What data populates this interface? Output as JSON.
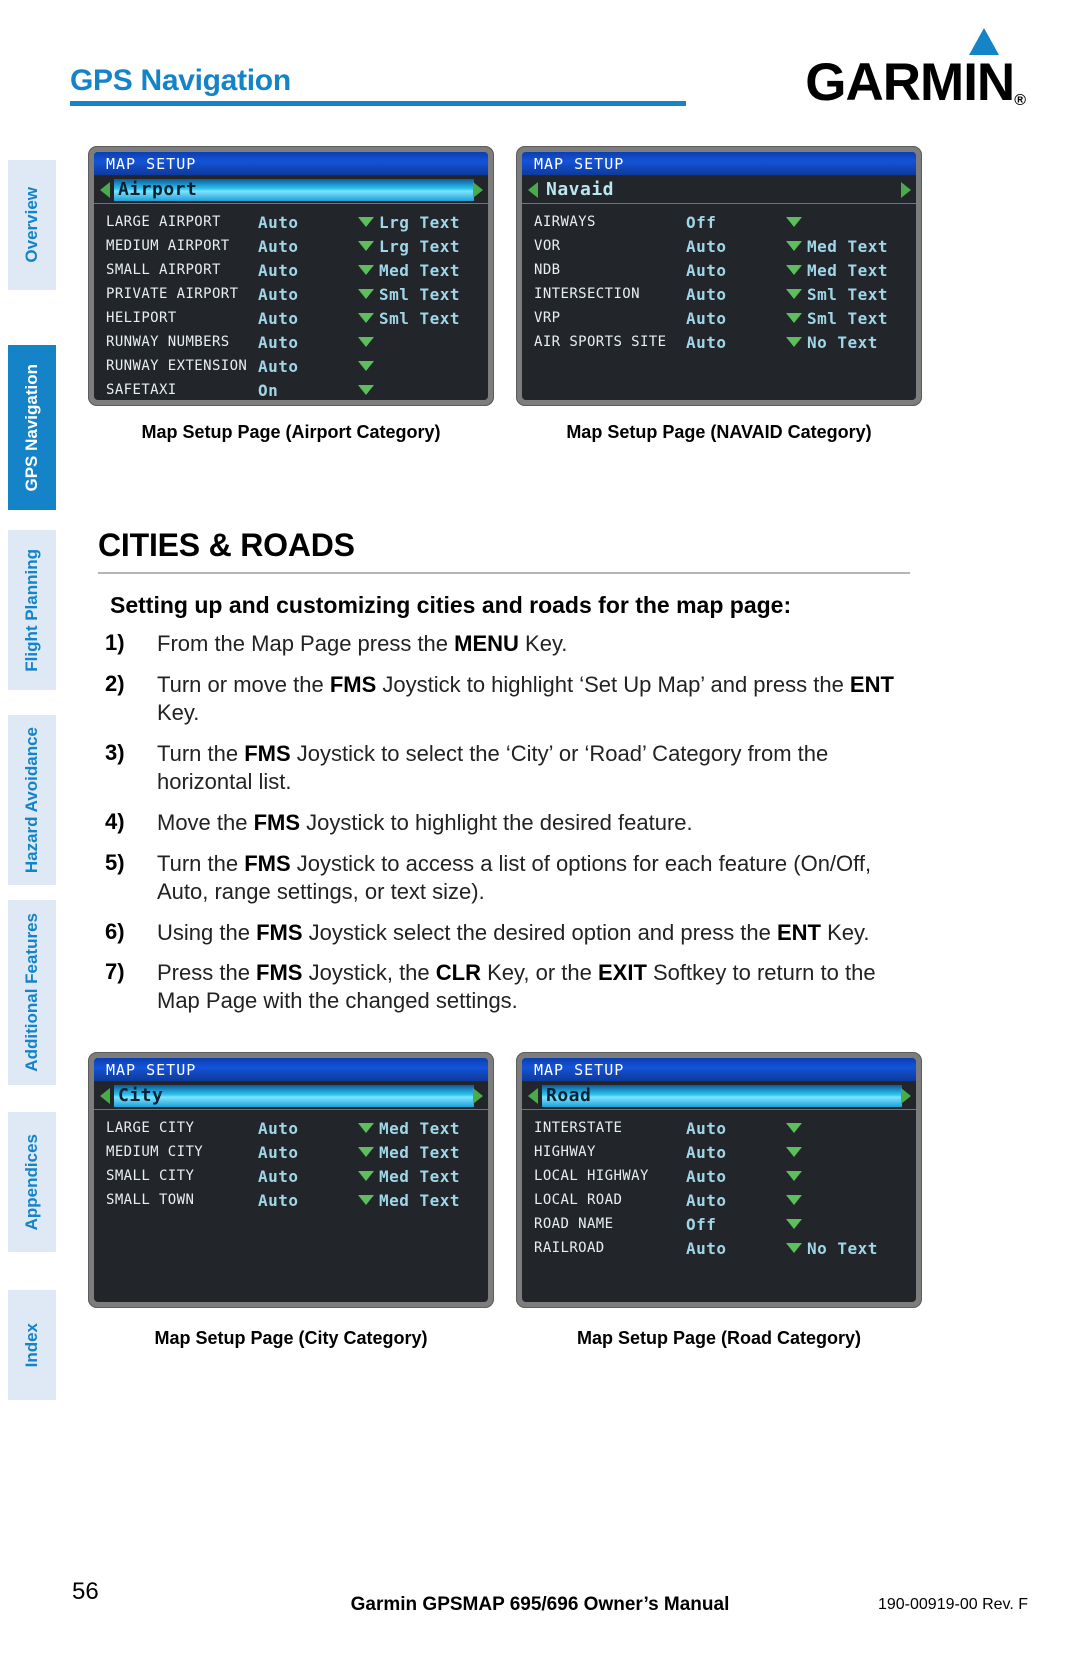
{
  "header": {
    "title": "GPS Navigation",
    "brand": "GARMIN",
    "brand_mark": "®"
  },
  "sidebar": {
    "items": [
      {
        "label": "Overview",
        "active": false
      },
      {
        "label": "GPS Navigation",
        "active": true
      },
      {
        "label": "Flight Planning",
        "active": false
      },
      {
        "label": "Hazard Avoidance",
        "active": false
      },
      {
        "label": "Additional Features",
        "active": false
      },
      {
        "label": "Appendices",
        "active": false
      },
      {
        "label": "Index",
        "active": false
      }
    ],
    "accent_color": "#1583c8",
    "inactive_bg": "#dfe9f5"
  },
  "section": {
    "heading": "CITIES & ROADS",
    "lead": "Setting up and customizing cities and roads for the map page:"
  },
  "steps": [
    {
      "num": "1)",
      "html": "From the Map Page press the <b>MENU</b> Key."
    },
    {
      "num": "2)",
      "html": "Turn or move the <b>FMS</b> Joystick to highlight ‘Set Up Map’ and press the <b>ENT</b> Key."
    },
    {
      "num": "3)",
      "html": "Turn the <b>FMS</b> Joystick to select the ‘City’ or ‘Road’ Category from the horizontal list."
    },
    {
      "num": "4)",
      "html": "Move the <b>FMS</b> Joystick to highlight the desired feature."
    },
    {
      "num": "5)",
      "html": "Turn the <b>FMS</b> Joystick to access a list of options for each feature (On/Off, Auto, range settings, or text size)."
    },
    {
      "num": "6)",
      "html": "Using the <b>FMS</b> Joystick select the desired option and press the <b>ENT</b> Key."
    },
    {
      "num": "7)",
      "html": "Press the <b>FMS</b> Joystick, the <b>CLR</b> Key, or the <b>EXIT</b> Softkey to return to the Map Page with the changed settings."
    }
  ],
  "screens": {
    "airport": {
      "title": "MAP SETUP",
      "category": "Airport",
      "category_highlighted": true,
      "left_arrow": true,
      "right_arrow": true,
      "caption": "Map Setup Page (Airport Category)",
      "rows": [
        {
          "name": "LARGE AIRPORT",
          "value": "Auto",
          "text": "Lrg Text"
        },
        {
          "name": "MEDIUM AIRPORT",
          "value": "Auto",
          "text": "Lrg Text"
        },
        {
          "name": "SMALL AIRPORT",
          "value": "Auto",
          "text": "Med Text"
        },
        {
          "name": "PRIVATE AIRPORT",
          "value": "Auto",
          "text": "Sml Text"
        },
        {
          "name": "HELIPORT",
          "value": "Auto",
          "text": "Sml Text"
        },
        {
          "name": "RUNWAY NUMBERS",
          "value": "Auto",
          "text": ""
        },
        {
          "name": "RUNWAY EXTENSION",
          "value": "Auto",
          "text": ""
        },
        {
          "name": "SAFETAXI",
          "value": "On",
          "text": ""
        }
      ]
    },
    "navaid": {
      "title": "MAP SETUP",
      "category": "Navaid",
      "category_highlighted": false,
      "left_arrow": true,
      "right_arrow": true,
      "caption": "Map Setup Page (NAVAID Category)",
      "rows": [
        {
          "name": "AIRWAYS",
          "value": "Off",
          "text": ""
        },
        {
          "name": "VOR",
          "value": "Auto",
          "text": "Med Text"
        },
        {
          "name": "NDB",
          "value": "Auto",
          "text": "Med Text"
        },
        {
          "name": "INTERSECTION",
          "value": "Auto",
          "text": "Sml Text"
        },
        {
          "name": "VRP",
          "value": "Auto",
          "text": "Sml Text"
        },
        {
          "name": "AIR SPORTS SITE",
          "value": "Auto",
          "text": "No Text"
        }
      ]
    },
    "city": {
      "title": "MAP SETUP",
      "category": "City",
      "category_highlighted": true,
      "left_arrow": true,
      "right_arrow": true,
      "caption": "Map Setup Page (City Category)",
      "rows": [
        {
          "name": "LARGE CITY",
          "value": "Auto",
          "text": "Med Text"
        },
        {
          "name": "MEDIUM CITY",
          "value": "Auto",
          "text": "Med Text"
        },
        {
          "name": "SMALL CITY",
          "value": "Auto",
          "text": "Med Text"
        },
        {
          "name": "SMALL TOWN",
          "value": "Auto",
          "text": "Med Text"
        }
      ]
    },
    "road": {
      "title": "MAP SETUP",
      "category": "Road",
      "category_highlighted": true,
      "left_arrow": true,
      "right_arrow": true,
      "caption": "Map Setup Page (Road Category)",
      "rows": [
        {
          "name": "INTERSTATE",
          "value": "Auto",
          "text": ""
        },
        {
          "name": "HIGHWAY",
          "value": "Auto",
          "text": ""
        },
        {
          "name": "LOCAL HIGHWAY",
          "value": "Auto",
          "text": ""
        },
        {
          "name": "LOCAL ROAD",
          "value": "Auto",
          "text": ""
        },
        {
          "name": "ROAD NAME",
          "value": "Off",
          "text": ""
        },
        {
          "name": "RAILROAD",
          "value": "Auto",
          "text": "No Text"
        }
      ]
    }
  },
  "footer": {
    "page_number": "56",
    "center": "Garmin GPSMAP 695/696 Owner’s Manual",
    "right": "190-00919-00  Rev. F"
  }
}
